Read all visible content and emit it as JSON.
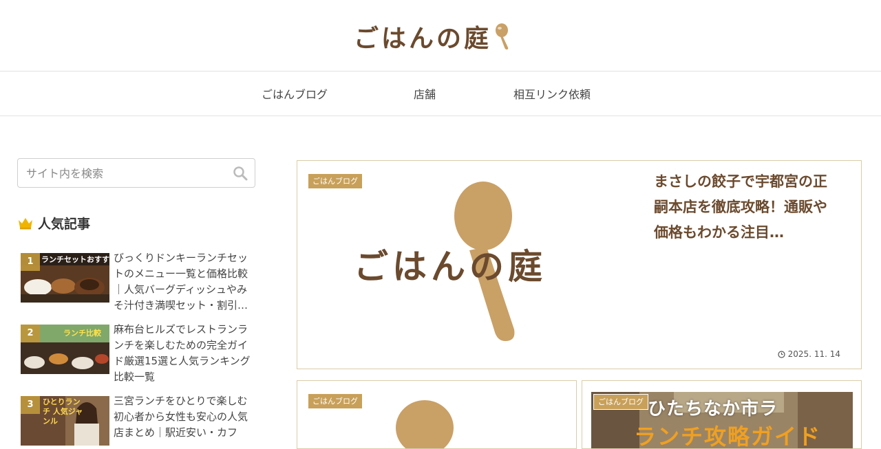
{
  "header": {
    "logo_text": "ごはんの庭",
    "logo_icon": "spoon-icon"
  },
  "nav": {
    "items": [
      {
        "label": "ごはんブログ"
      },
      {
        "label": "店舗"
      },
      {
        "label": "相互リンク依頼"
      }
    ]
  },
  "sidebar": {
    "search": {
      "placeholder": "サイト内を検索",
      "icon": "search-icon"
    },
    "popular": {
      "title": "人気記事",
      "icon": "crown-icon",
      "items": [
        {
          "rank": "1",
          "title": "びっくりドンキーランチセットのメニュー一覧と価格比較｜人気バーグディッシュやみそ汁付き満喫セット・割引…",
          "thumb_text": "ランチセットおすすめ"
        },
        {
          "rank": "2",
          "title": "麻布台ヒルズでレストランランチを楽しむための完全ガイド厳選15選と人気ランキング比較一覧",
          "thumb_text": "ランチ比較"
        },
        {
          "rank": "3",
          "title": "三宮ランチをひとりで楽しむ初心者から女性も安心の人気店まとめ｜駅近安い・カフ",
          "thumb_text": "ひとりランチ 人気ジャンル"
        }
      ]
    }
  },
  "main": {
    "featured": {
      "category": "ごはんブログ",
      "title": "まさしの餃子で宇都宮の正嗣本店を徹底攻略！通販や価格もわかる注目…",
      "image_text": "ごはんの庭",
      "date": "2025. 11. 14"
    },
    "cards": [
      {
        "category": "ごはんブログ"
      },
      {
        "category": "ごはんブログ",
        "image_text_1": "ひたちなか市ラ",
        "image_text_2": "ランチ攻略ガイド"
      }
    ]
  },
  "colors": {
    "brand_brown": "#6b4a2e",
    "badge_gold": "#c8a05a",
    "spoon": "#c9a066",
    "card_border": "#d9cca8"
  }
}
